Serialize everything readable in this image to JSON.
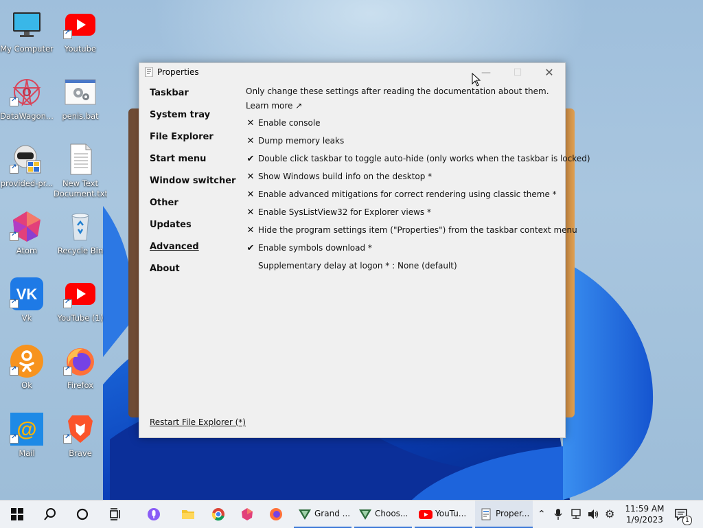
{
  "desktop": {
    "icons": [
      {
        "label": "My Computer",
        "icon": "monitor-icon"
      },
      {
        "label": "Youtube",
        "icon": "youtube-icon"
      },
      {
        "label": "DataWagon...",
        "icon": "datawagon-icon"
      },
      {
        "label": "penis.bat",
        "icon": "batch-file-icon"
      },
      {
        "label": "provided-pr...",
        "icon": "installer-icon"
      },
      {
        "label": "New Text Document.txt",
        "icon": "text-document-icon"
      },
      {
        "label": "Atom",
        "icon": "atom-icon"
      },
      {
        "label": "Recycle Bin",
        "icon": "recycle-bin-icon"
      },
      {
        "label": "Vk",
        "icon": "vk-icon"
      },
      {
        "label": "YouTube (1)",
        "icon": "youtube-icon"
      },
      {
        "label": "Ok",
        "icon": "odnoklassniki-icon"
      },
      {
        "label": "Firefox",
        "icon": "firefox-icon"
      },
      {
        "label": "Mail",
        "icon": "mail-icon"
      },
      {
        "label": "Brave",
        "icon": "brave-icon"
      }
    ]
  },
  "window": {
    "title": "Properties",
    "nav": [
      "Taskbar",
      "System tray",
      "File Explorer",
      "Start menu",
      "Window switcher",
      "Other",
      "Updates",
      "Advanced",
      "About"
    ],
    "active_nav": "Advanced",
    "intro": "Only change these settings after reading the documentation about them.",
    "learn_more": "Learn more ↗",
    "options": [
      {
        "mark": "✕",
        "checked": false,
        "text": "Enable console"
      },
      {
        "mark": "✕",
        "checked": false,
        "text": "Dump memory leaks"
      },
      {
        "mark": "✔",
        "checked": true,
        "text": "Double click taskbar to toggle auto-hide (only works when the taskbar is locked)"
      },
      {
        "mark": "✕",
        "checked": false,
        "text": "Show Windows build info on the desktop *"
      },
      {
        "mark": "✕",
        "checked": false,
        "text": "Enable advanced mitigations for correct rendering using classic theme *"
      },
      {
        "mark": "✕",
        "checked": false,
        "text": "Enable SysListView32 for Explorer views *"
      },
      {
        "mark": "✕",
        "checked": false,
        "text": "Hide the program settings item (\"Properties\") from the taskbar context menu"
      },
      {
        "mark": "✔",
        "checked": true,
        "text": "Enable symbols download *"
      },
      {
        "mark": "",
        "checked": null,
        "text": "Supplementary delay at logon * : None (default)"
      }
    ],
    "restart": "Restart File Explorer (*)"
  },
  "taskbar": {
    "apps": [
      {
        "label": "Grand ...",
        "icon": "vivaldi-icon"
      },
      {
        "label": "Choos...",
        "icon": "vivaldi-icon"
      },
      {
        "label": "YouTu...",
        "icon": "youtube-icon"
      },
      {
        "label": "Proper...",
        "icon": "properties-icon"
      }
    ],
    "time": "11:59 AM",
    "date": "1/9/2023",
    "notification_count": "1"
  },
  "colors": {
    "accent": "#3b78d8",
    "youtube_red": "#ff0000",
    "window_bg": "#f0f0f0"
  }
}
